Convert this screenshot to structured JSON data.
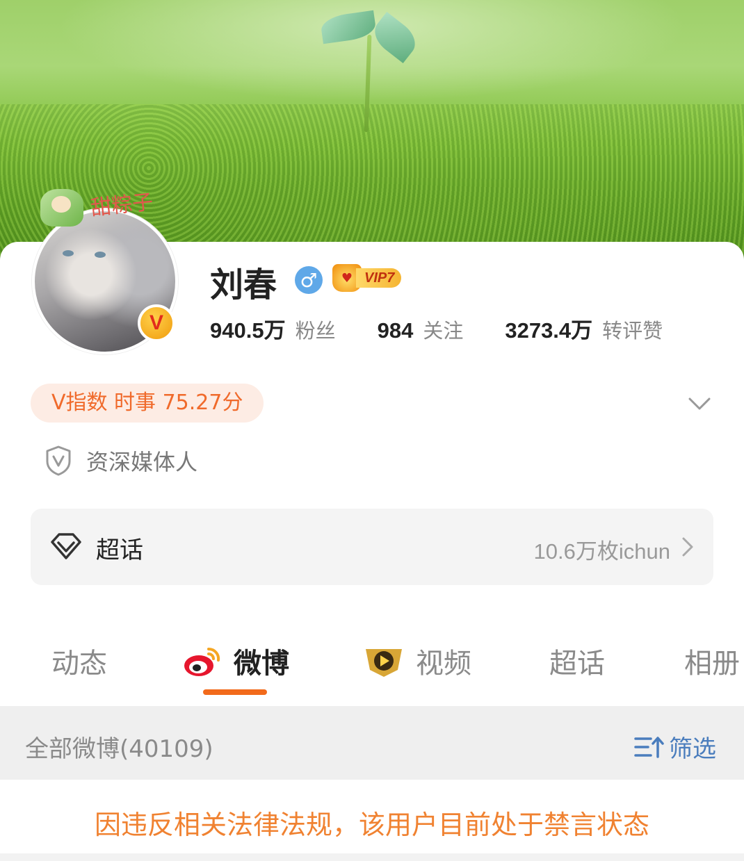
{
  "profile": {
    "avatar_tag": "甜粽子",
    "name": "刘春",
    "gender_symbol": "♂",
    "vip_label": "VIP7",
    "verify_mark": "V",
    "stats": [
      {
        "value": "940.5万",
        "label": "粉丝"
      },
      {
        "value": "984",
        "label": "关注"
      },
      {
        "value": "3273.4万",
        "label": "转评赞"
      }
    ],
    "v_index": "V指数 时事 75.27分",
    "certification": "资深媒体人"
  },
  "supertopic": {
    "title": "超话",
    "value": "10.6万枚ichun"
  },
  "tabs": [
    {
      "label": "动态",
      "active": false
    },
    {
      "label": "微博",
      "active": true
    },
    {
      "label": "视频",
      "active": false
    },
    {
      "label": "超话",
      "active": false
    },
    {
      "label": "相册",
      "active": false
    }
  ],
  "filter": {
    "count_label": "全部微博(40109)",
    "filter_label": "筛选"
  },
  "notice": "因违反相关法律法规，该用户目前处于禁言状态",
  "colors": {
    "accent_orange": "#f26a1b",
    "link_blue": "#4a7dbd",
    "notice_orange": "#f08231",
    "vindex_bg": "#fdece4"
  },
  "icons": [
    "gender-male-icon",
    "vip-crown-icon",
    "verified-v-icon",
    "chevron-down-icon",
    "shield-v-icon",
    "diamond-icon",
    "chevron-right-icon",
    "weibo-logo-icon",
    "video-play-icon",
    "filter-icon"
  ]
}
